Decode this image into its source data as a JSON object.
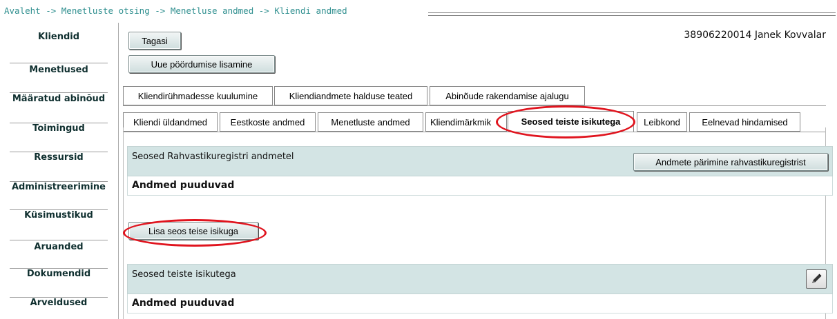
{
  "breadcrumb": {
    "text": "Avaleht -> Menetluste otsing -> Menetluse andmed -> Kliendi andmed"
  },
  "sidebar": {
    "items": [
      {
        "label": "Kliendid"
      },
      {
        "label": "Menetlused"
      },
      {
        "label": "Määratud abinõud"
      },
      {
        "label": "Toimingud"
      },
      {
        "label": "Ressursid"
      },
      {
        "label": "Administreerimine"
      },
      {
        "label": "Küsimustikud"
      },
      {
        "label": "Aruanded"
      },
      {
        "label": "Dokumendid"
      },
      {
        "label": "Arveldused"
      }
    ]
  },
  "header": {
    "back_label": "Tagasi",
    "add_request_label": "Uue pöördumise lisamine",
    "user": "38906220014 Janek Kovvalar"
  },
  "tabs_row1": [
    {
      "label": "Kliendirühmadesse kuulumine"
    },
    {
      "label": "Kliendiandmete halduse teated"
    },
    {
      "label": "Abinõude rakendamise ajalugu"
    }
  ],
  "tabs_row2": [
    {
      "label": "Kliendi üldandmed"
    },
    {
      "label": "Eestkoste andmed"
    },
    {
      "label": "Menetluste andmed"
    },
    {
      "label": "Kliendimärkmik"
    },
    {
      "label": "Seosed teiste isikutega",
      "active": true
    },
    {
      "label": "Leibkond"
    },
    {
      "label": "Eelnevad hindamised"
    }
  ],
  "registry_panel": {
    "title": "Seosed Rahvastikuregistri andmetel",
    "query_button": "Andmete pärimine rahvastikuregistrist",
    "empty_text": "Andmed puuduvad"
  },
  "add_relation_label": "Lisa seos teise isikuga",
  "relations_panel": {
    "title": "Seosed teiste isikutega",
    "empty_text": "Andmed puuduvad",
    "edit_icon": "pencil-icon"
  },
  "colors": {
    "panel_header": "#d3e4e4",
    "highlight_circle": "#e0141e",
    "breadcrumb": "#2f8f8f"
  }
}
